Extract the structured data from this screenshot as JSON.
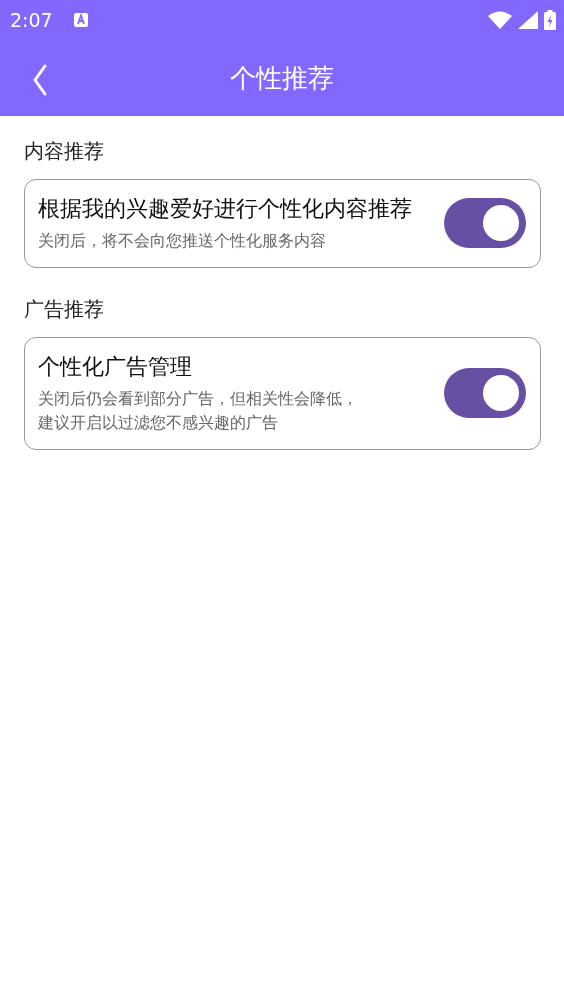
{
  "status_bar": {
    "time": "2:07"
  },
  "app_bar": {
    "title": "个性推荐"
  },
  "sections": [
    {
      "header": "内容推荐",
      "items": [
        {
          "title": "根据我的兴趣爱好进行个性化内容推荐",
          "description_lines": [
            "关闭后，将不会向您推送个性化服务内容"
          ],
          "on": true
        }
      ]
    },
    {
      "header": "广告推荐",
      "items": [
        {
          "title": "个性化广告管理",
          "description_lines": [
            "关闭后仍会看到部分广告，但相关性会降低，",
            "建议开启以过滤您不感兴趣的广告"
          ],
          "on": true
        }
      ]
    }
  ]
}
